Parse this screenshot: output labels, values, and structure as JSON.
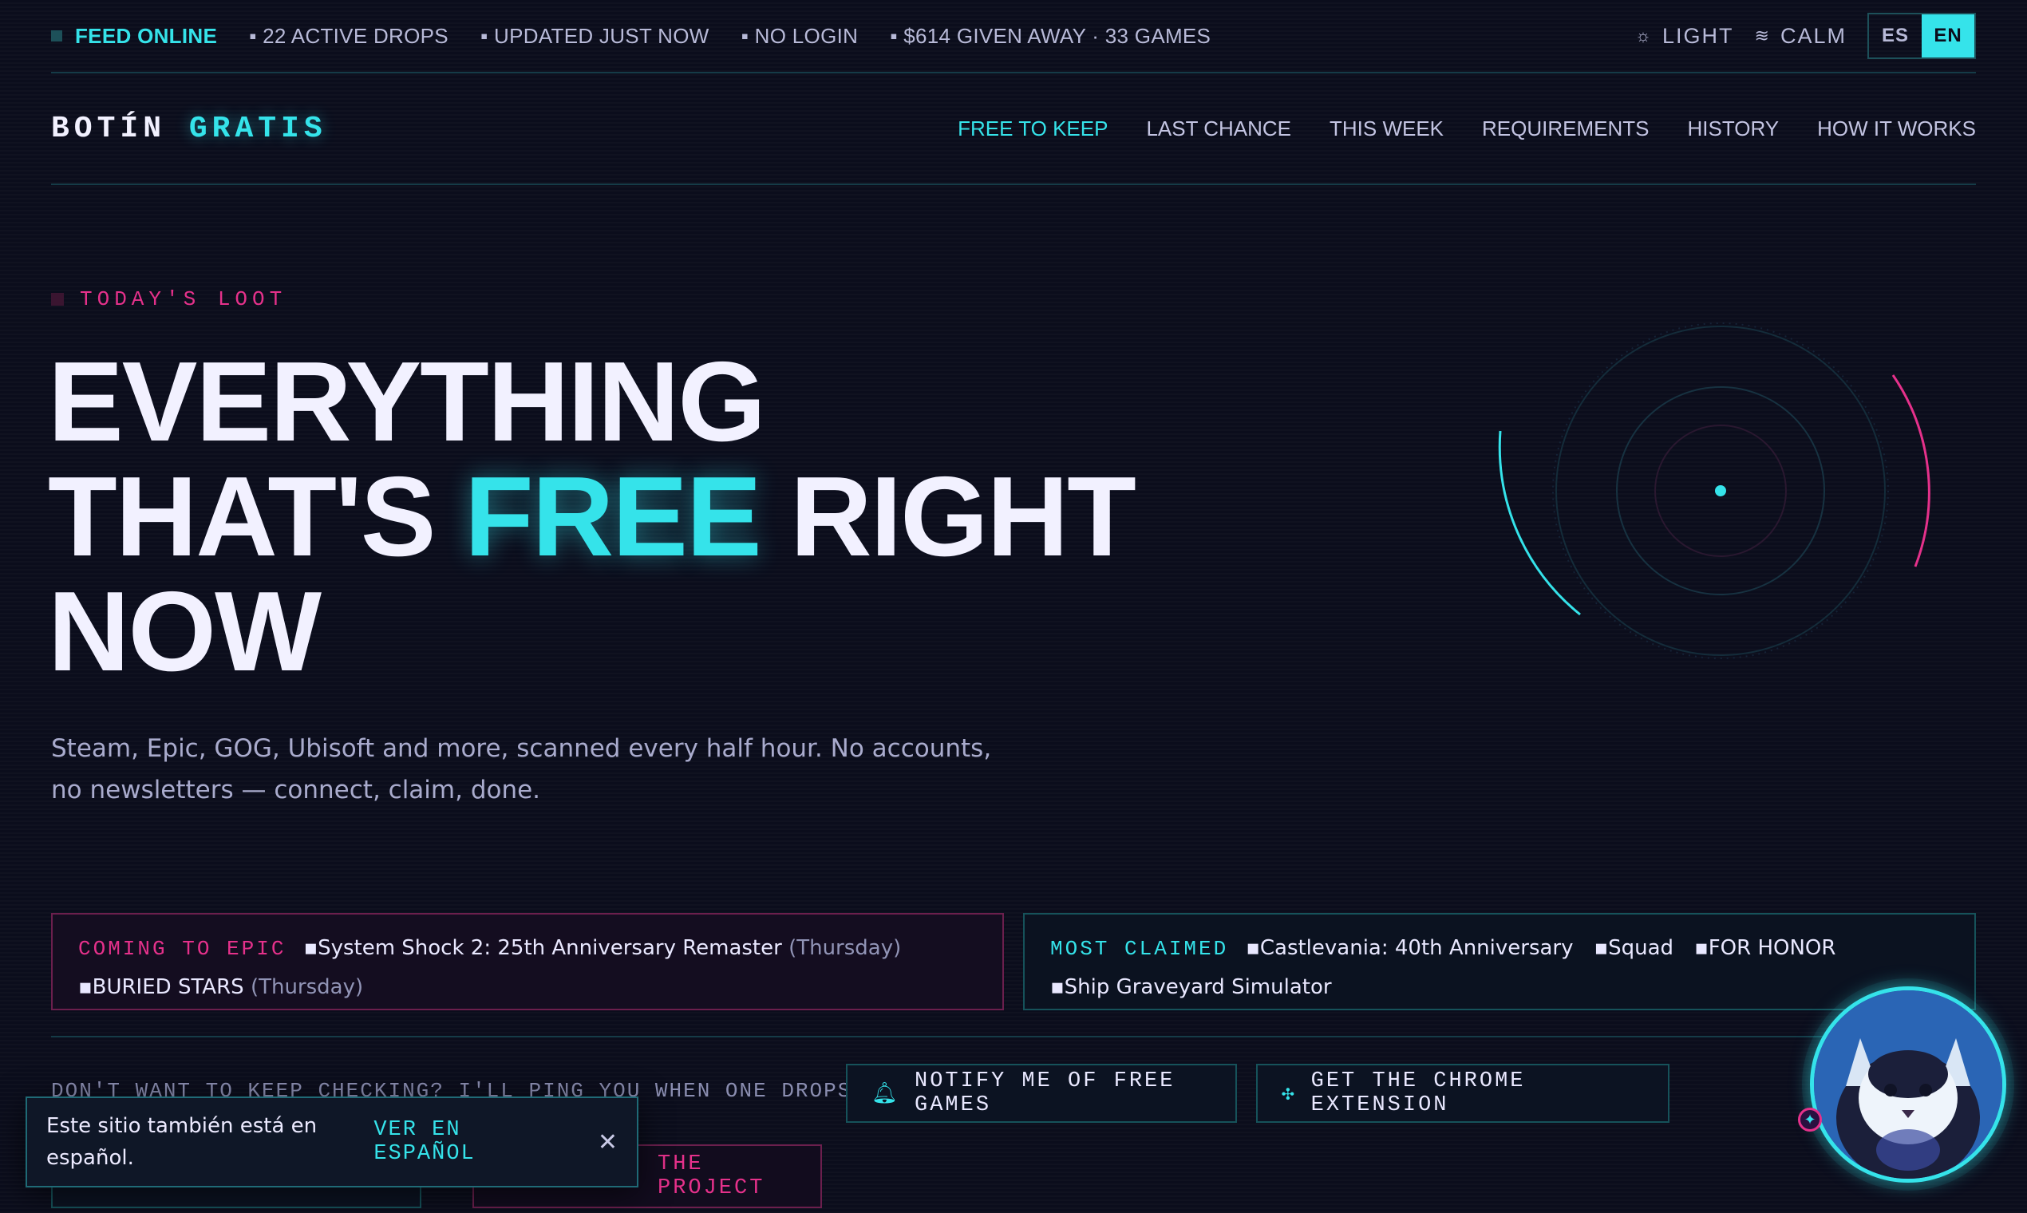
{
  "topbar": {
    "status": "FEED ONLINE",
    "items": [
      "22 ACTIVE DROPS",
      "UPDATED JUST NOW",
      "NO LOGIN",
      "$614 GIVEN AWAY · 33 GAMES"
    ],
    "light_label": "LIGHT",
    "calm_label": "CALM",
    "lang_es": "ES",
    "lang_en": "EN",
    "active_lang": "EN"
  },
  "nav": {
    "logo_main": "BOTÍN",
    "logo_hl": "GRATIS",
    "items": [
      "FREE TO KEEP",
      "LAST CHANCE",
      "THIS WEEK",
      "REQUIREMENTS",
      "HISTORY",
      "HOW IT WORKS"
    ],
    "active": "FREE TO KEEP"
  },
  "hero": {
    "eyebrow": "TODAY'S LOOT",
    "line1": "EVERYTHING",
    "line2_a": "THAT'S ",
    "line2_free": "FREE",
    "line2_b": " RIGHT",
    "line3": "NOW",
    "subtitle": "Steam, Epic, GOG, Ubisoft and more, scanned every half hour. No accounts, no newsletters — connect, claim, done."
  },
  "coming": {
    "label": "COMING TO EPIC",
    "games": [
      {
        "name": "System Shock 2: 25th Anniversary Remaster",
        "day": "(Thursday)"
      },
      {
        "name": "BURIED STARS",
        "day": "(Thursday)"
      }
    ]
  },
  "claimed": {
    "label": "MOST CLAIMED",
    "games": [
      "Castlevania: 40th Anniversary",
      "Squad",
      "FOR HONOR",
      "Ship Graveyard Simulator"
    ]
  },
  "cta": {
    "text": "DON'T WANT TO KEEP CHECKING? I'LL PING YOU WHEN ONE DROPS →",
    "notify": "NOTIFY ME OF FREE GAMES",
    "extension": "GET THE CHROME EXTENSION",
    "project": "THE PROJECT"
  },
  "popup": {
    "message": "Este sitio también está en español.",
    "link": "VER EN ESPAÑOL",
    "close": "✕"
  },
  "colors": {
    "accent": "#35e3ea",
    "pink": "#e5318b",
    "bg": "#0b0d1c"
  }
}
